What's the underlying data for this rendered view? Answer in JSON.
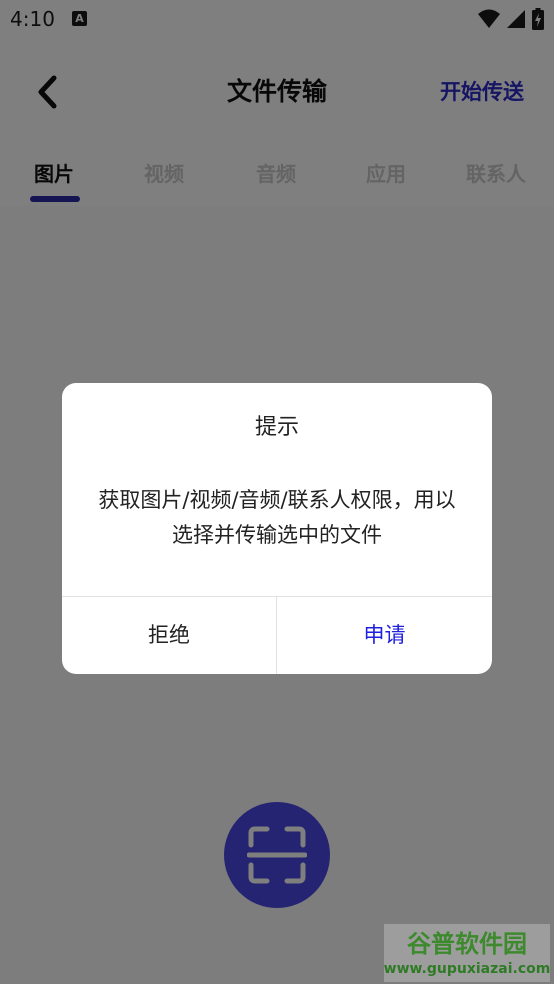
{
  "status_bar": {
    "time": "4:10",
    "notification_icon": "A",
    "icons": [
      "wifi-icon",
      "signal-icon",
      "battery-icon"
    ]
  },
  "header": {
    "title": "文件传输",
    "action_label": "开始传送",
    "back_icon": "chevron-left-icon"
  },
  "tabs": [
    {
      "label": "图片",
      "active": true
    },
    {
      "label": "视频",
      "active": false
    },
    {
      "label": "音频",
      "active": false
    },
    {
      "label": "应用",
      "active": false
    },
    {
      "label": "联系人",
      "active": false
    }
  ],
  "scan_button": {
    "icon": "scan-icon"
  },
  "dialog": {
    "title": "提示",
    "message_line1": "获取图片/视频/音频/联系人权限，用以",
    "message_line2": "选择并传输选中的文件",
    "deny_label": "拒绝",
    "apply_label": "申请"
  },
  "watermark": {
    "brand": "谷普软件园",
    "url": "www.gupuxiazai.com"
  },
  "colors": {
    "accent": "#2a2ac8",
    "tab_underline": "#2a2aa8",
    "scan_button": "#4848e6",
    "apply_text": "#2020e0"
  }
}
